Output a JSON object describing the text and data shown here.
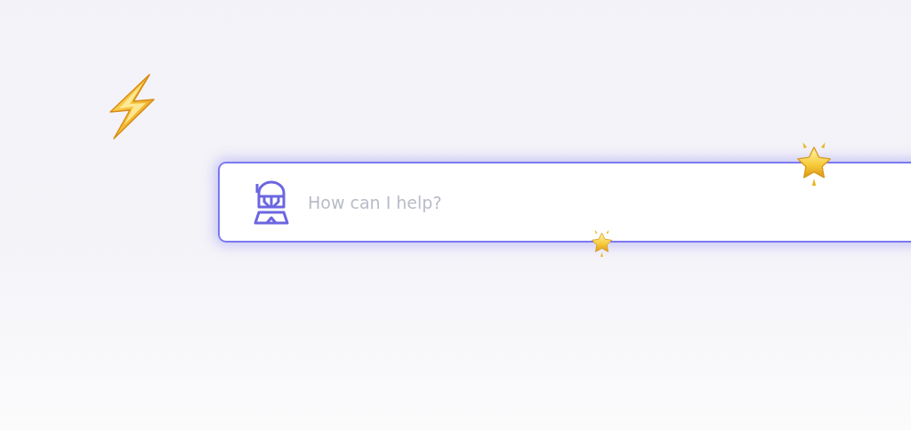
{
  "search": {
    "placeholder": "How can I help?"
  }
}
